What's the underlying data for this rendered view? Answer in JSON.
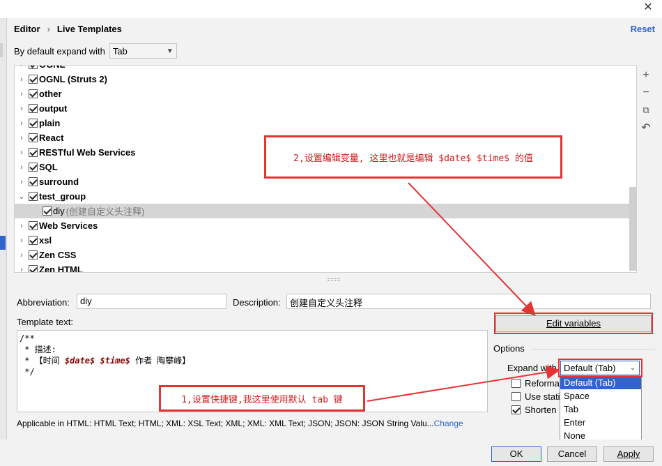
{
  "window": {
    "close_glyph": "✕"
  },
  "breadcrumb": {
    "parent": "Editor",
    "separator": "›",
    "current": "Live Templates"
  },
  "reset_label": "Reset",
  "expand_default": {
    "label": "By default expand with",
    "value": "Tab"
  },
  "tree": {
    "rows": [
      {
        "label": "OGNL",
        "expanded": false,
        "checked": true
      },
      {
        "label": "OGNL (Struts 2)",
        "expanded": false,
        "checked": true
      },
      {
        "label": "other",
        "expanded": false,
        "checked": true
      },
      {
        "label": "output",
        "expanded": false,
        "checked": true
      },
      {
        "label": "plain",
        "expanded": false,
        "checked": true
      },
      {
        "label": "React",
        "expanded": false,
        "checked": true
      },
      {
        "label": "RESTful Web Services",
        "expanded": false,
        "checked": true
      },
      {
        "label": "SQL",
        "expanded": false,
        "checked": true
      },
      {
        "label": "surround",
        "expanded": false,
        "checked": true
      },
      {
        "label": "test_group",
        "expanded": true,
        "checked": true
      },
      {
        "label": "diy",
        "description": "(创建自定义头注释)",
        "child": true,
        "checked": true,
        "selected": true
      },
      {
        "label": "Web Services",
        "expanded": false,
        "checked": true
      },
      {
        "label": "xsl",
        "expanded": false,
        "checked": true
      },
      {
        "label": "Zen CSS",
        "expanded": false,
        "checked": true
      },
      {
        "label": "Zen HTML",
        "expanded": false,
        "checked": true
      }
    ],
    "expand_chevron": "›",
    "collapse_chevron": "⌄",
    "tools": [
      "+",
      "−",
      "⧉",
      "↶"
    ]
  },
  "abbreviation": {
    "label": "Abbreviation:",
    "value": "diy"
  },
  "description": {
    "label": "Description:",
    "value": "创建自定义头注释"
  },
  "template_text": {
    "label": "Template text:",
    "line1": "/**",
    "line2": " * 描述:",
    "line3_prefix": " * 【时间 ",
    "var_date": "$date$",
    "var_time": "$time$",
    "line3_suffix": " 作者 陶攀峰】",
    "line4": " */"
  },
  "edit_variables_label": "Edit variables",
  "options": {
    "label": "Options",
    "expand_with_label": "Expand with",
    "expand_with_value": "Default (Tab)",
    "dropdown_items": [
      "Default (Tab)",
      "Space",
      "Tab",
      "Enter",
      "None"
    ],
    "checkboxes": [
      {
        "label": "Reformat",
        "checked": false
      },
      {
        "label": "Use static",
        "checked": false
      },
      {
        "label": "Shorten F",
        "checked": true
      }
    ]
  },
  "applicable": {
    "text": "Applicable in HTML: HTML Text; HTML; XML: XSL Text; XML; XML: XML Text; JSON; JSON: JSON String Valu...",
    "link": "Change"
  },
  "buttons": {
    "ok": "OK",
    "cancel": "Cancel",
    "apply": "Apply"
  },
  "annotations": {
    "note2": "2,设置编辑变量, 这里也就是编辑 $date$ $time$ 的值",
    "note1": "1,设置快捷键,我这里使用默认 tab 键",
    "color": "#e53333"
  }
}
